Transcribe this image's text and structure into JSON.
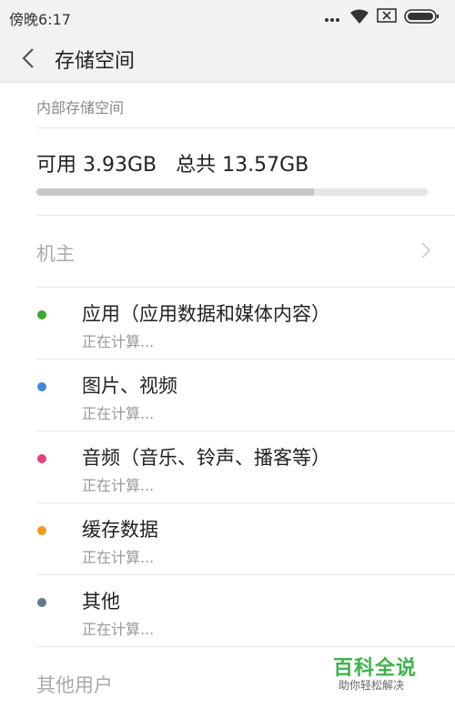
{
  "status_bar": {
    "time": "傍晚6:17",
    "icons": [
      "signal-dots-icon",
      "wifi-icon",
      "sim-error-icon",
      "battery-icon"
    ]
  },
  "header": {
    "title": "存储空间",
    "back_icon": "chevron-left-icon"
  },
  "storage": {
    "section_label": "内部存储空间",
    "available": "可用 3.93GB",
    "total": "总共 13.57GB",
    "progress_fraction": 0.71
  },
  "owner": {
    "label": "机主",
    "chevron_icon": "chevron-right-icon"
  },
  "categories": [
    {
      "title": "应用（应用数据和媒体内容）",
      "status": "正在计算...",
      "dot_color": "#3aa832"
    },
    {
      "title": "图片、视频",
      "status": "正在计算...",
      "dot_color": "#3f86e0"
    },
    {
      "title": "音频（音乐、铃声、播客等）",
      "status": "正在计算...",
      "dot_color": "#e8407a"
    },
    {
      "title": "缓存数据",
      "status": "正在计算...",
      "dot_color": "#f39a1e"
    },
    {
      "title": "其他",
      "status": "正在计算...",
      "dot_color": "#66778f"
    }
  ],
  "other_users": {
    "label": "其他用户"
  },
  "watermark": {
    "title": "百科全说",
    "subtitle": "助你轻松解决"
  },
  "colors": {
    "header_bg": "#f2f2f2",
    "progress_track": "#e5e5e5",
    "progress_fill": "#c7c7c7",
    "brand_green": "#3bb44a"
  }
}
